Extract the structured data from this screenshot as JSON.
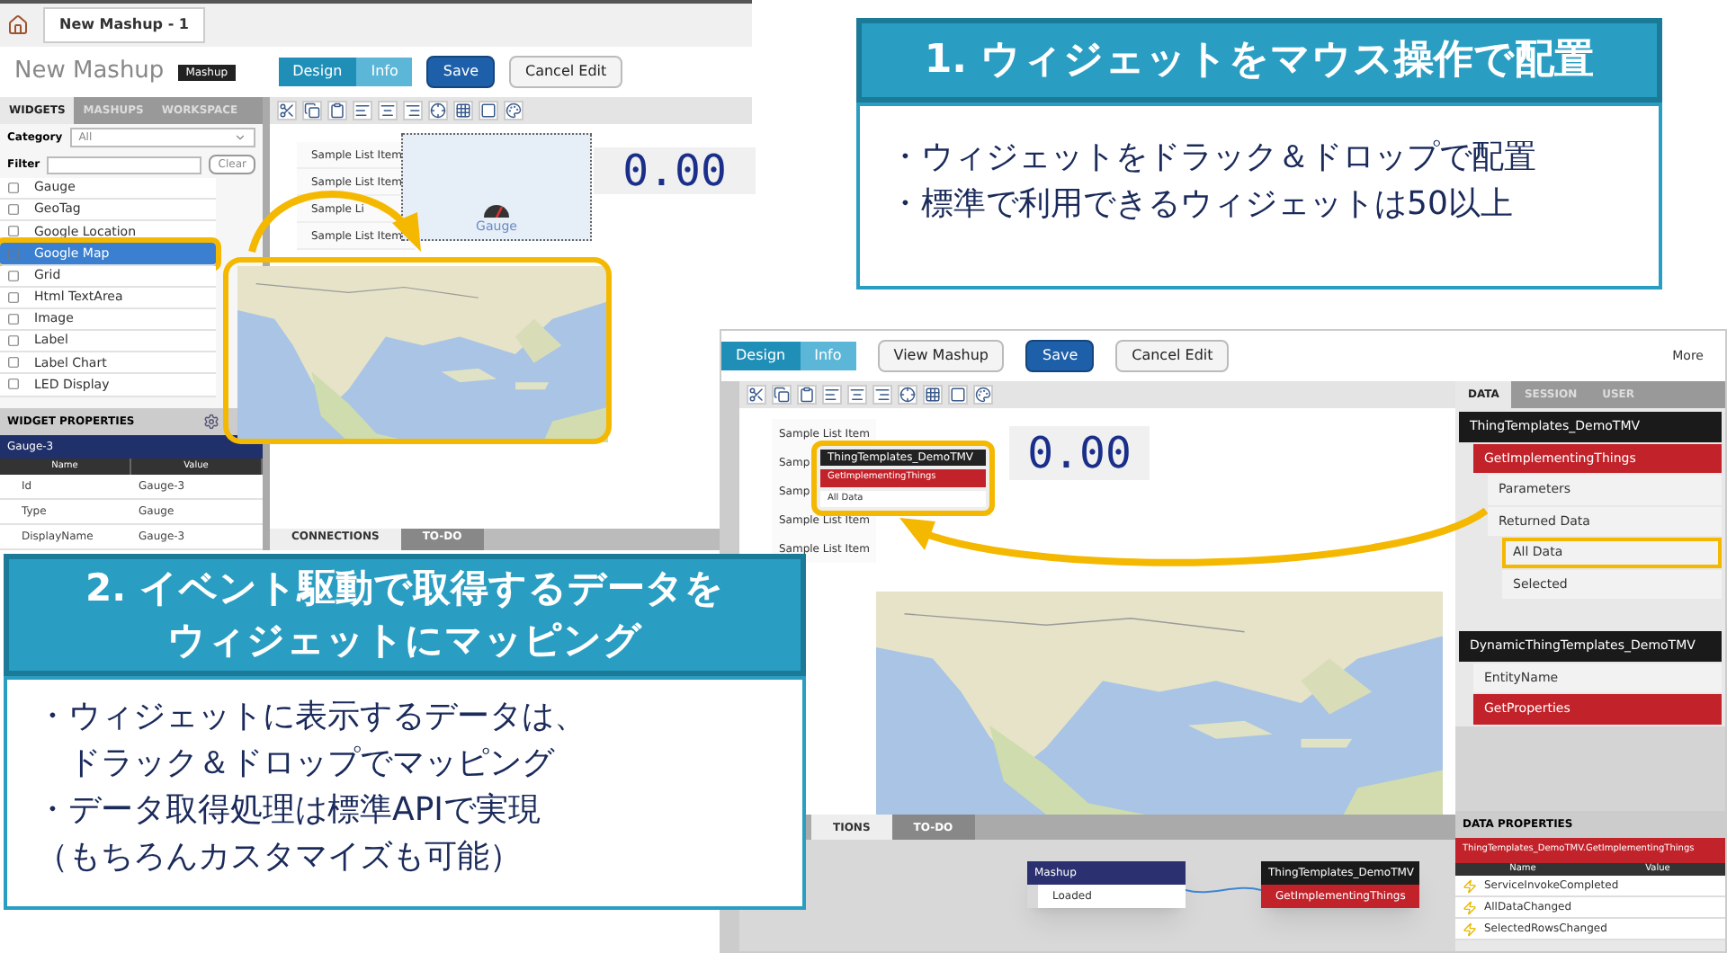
{
  "screen_1": {
    "tab": {
      "label": "New Mashup - 1"
    },
    "title": "New Mashup",
    "badge": "Mashup",
    "mode_tabs": [
      {
        "label": "Design",
        "selected": true
      },
      {
        "label": "Info",
        "selected": false
      }
    ],
    "buttons": [
      "Save",
      "Cancel Edit"
    ],
    "panel_tabs": [
      {
        "label": "WIDGETS",
        "selected": true
      },
      {
        "label": "MASHUPS",
        "selected": false
      },
      {
        "label": "WORKSPACE",
        "selected": false
      }
    ],
    "category": {
      "label": "Category",
      "value": "All"
    },
    "filter": {
      "label": "Filter",
      "button": "Clear"
    },
    "widgets": [
      {
        "label": "Gauge",
        "selected": false
      },
      {
        "label": "GeoTag",
        "selected": false
      },
      {
        "label": "Google Location",
        "selected": false
      },
      {
        "label": "Google Map",
        "selected": true
      },
      {
        "label": "Grid",
        "selected": false
      },
      {
        "label": "Html TextArea",
        "selected": false
      },
      {
        "label": "Image",
        "selected": false
      },
      {
        "label": "Label",
        "selected": false
      },
      {
        "label": "Label Chart",
        "selected": false
      },
      {
        "label": "LED Display",
        "selected": false
      }
    ],
    "properties": {
      "title": "WIDGET PROPERTIES",
      "selected_widget": "Gauge-3",
      "columns": [
        "Name",
        "Value"
      ],
      "rows": [
        {
          "name": "Id",
          "value": "Gauge-3"
        },
        {
          "name": "Type",
          "value": "Gauge"
        },
        {
          "name": "DisplayName",
          "value": "Gauge-3"
        }
      ]
    },
    "list_items": [
      "Sample List Item",
      "Sample List Item",
      "Sample Li",
      "Sample List Item"
    ],
    "gauge_label": "Gauge",
    "led_value": "0.00",
    "bottom_tabs": [
      {
        "label": "CONNECTIONS",
        "selected": true
      },
      {
        "label": "TO-DO",
        "selected": false
      }
    ]
  },
  "screen_2": {
    "mode_tabs": [
      {
        "label": "Design",
        "selected": true
      },
      {
        "label": "Info",
        "selected": false
      }
    ],
    "buttons": [
      "View Mashup",
      "Save",
      "Cancel Edit"
    ],
    "more": "More",
    "list_items": [
      "Sample List Item",
      "Samp",
      "Samp",
      "Sample List Item",
      "Sample List Item"
    ],
    "popup": {
      "title": "ThingTemplates_DemoTMV",
      "service": "GetImplementingThings",
      "item": "All Data"
    },
    "led_value": "0.00",
    "data_tabs": [
      {
        "label": "DATA",
        "selected": true
      },
      {
        "label": "SESSION",
        "selected": false
      },
      {
        "label": "USER",
        "selected": false
      }
    ],
    "tree": [
      {
        "label": "ThingTemplates_DemoTMV",
        "kind": "thing",
        "highlighted": false,
        "children": [
          {
            "label": "GetImplementingThings",
            "kind": "service",
            "highlighted": false,
            "children": [
              {
                "label": "Parameters",
                "kind": "node",
                "highlighted": false
              },
              {
                "label": "Returned Data",
                "kind": "node",
                "highlighted": false,
                "children": [
                  {
                    "label": "All Data",
                    "kind": "node",
                    "highlighted": true
                  },
                  {
                    "label": "Selected",
                    "kind": "node",
                    "highlighted": false
                  }
                ]
              }
            ]
          }
        ]
      },
      {
        "label": "DynamicThingTemplates_DemoTMV",
        "kind": "thing",
        "highlighted": false,
        "children": [
          {
            "label": "EntityName",
            "kind": "node",
            "highlighted": false
          },
          {
            "label": "GetProperties",
            "kind": "service",
            "highlighted": false
          }
        ]
      }
    ],
    "data_properties": {
      "title": "DATA PROPERTIES",
      "service": "ThingTemplates_DemoTMV.GetImplementingThings",
      "columns": [
        "Name",
        "Value"
      ],
      "events": [
        "ServiceInvokeCompleted",
        "AllDataChanged",
        "SelectedRowsChanged"
      ]
    },
    "bottom_tabs": [
      {
        "label": "TIONS",
        "selected": true
      },
      {
        "label": "TO-DO",
        "selected": false
      }
    ],
    "connections": [
      {
        "title": "Mashup",
        "item": "Loaded",
        "kind": "mashup"
      },
      {
        "title": "ThingTemplates_DemoTMV",
        "item": "GetImplementingThings",
        "kind": "thing"
      }
    ]
  },
  "callout_1": {
    "title": "1. ウィジェットをマウス操作で配置",
    "bullets": [
      "・ウィジェットをドラック＆ドロップで配置",
      "・標準で利用できるウィジェットは50以上"
    ]
  },
  "callout_2": {
    "title": [
      "2. イベント駆動で取得するデータを",
      "ウィジェットにマッピング"
    ],
    "bullets": [
      "・ウィジェットに表示するデータは、",
      "　ドラック＆ドロップでマッピング",
      "・データ取得処理は標準APIで実現",
      "（もちろんカスタマイズも可能）"
    ]
  }
}
